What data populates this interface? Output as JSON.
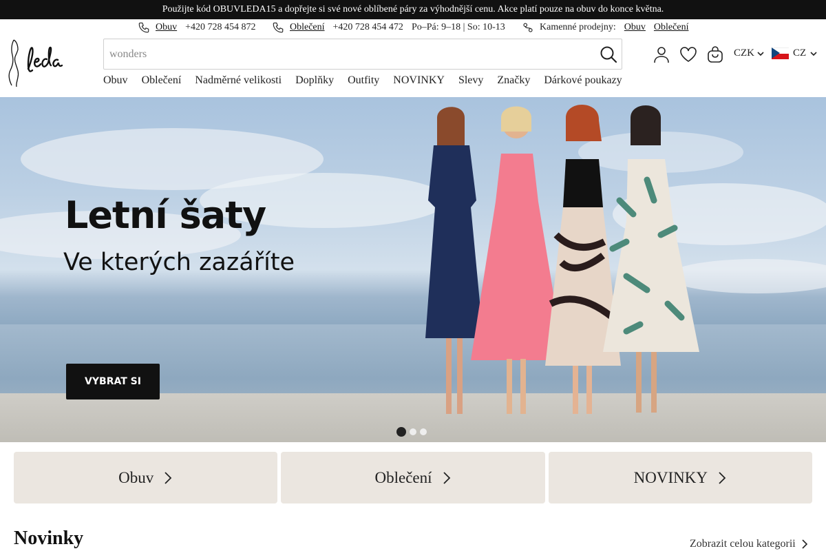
{
  "promo": {
    "text": "Použijte kód OBUVLEDA15 a dopřejte si své nové oblíbené páry za výhodnější cenu. Akce platí pouze na obuv do konce května."
  },
  "contacts": {
    "shoes_link": "Obuv",
    "shoes_phone": "+420 728 454 872",
    "clothes_link": "Oblečení",
    "clothes_phone": "+420 728 454 472",
    "hours": "Po–Pá: 9–18 | So: 10-13",
    "stores_label": "Kamenné prodejny:",
    "stores_shoes": "Obuv",
    "stores_clothes": "Oblečení"
  },
  "search": {
    "placeholder": "wonders"
  },
  "header": {
    "currency": "CZK",
    "language": "CZ"
  },
  "nav": [
    "Obuv",
    "Oblečení",
    "Nadměrné velikosti",
    "Doplňky",
    "Outfity",
    "NOVINKY",
    "Slevy",
    "Značky",
    "Dárkové poukazy"
  ],
  "hero": {
    "title": "Letní šaty",
    "subtitle": "Ve kterých zazáříte",
    "cta": "VYBRAT SI",
    "slides": 3,
    "active_slide": 1
  },
  "tiles": [
    "Obuv",
    "Oblečení",
    "NOVINKY"
  ],
  "section": {
    "title": "Novinky",
    "see_all": "Zobrazit celou kategorii"
  },
  "colors": {
    "dark": "#111111",
    "tile_bg": "#ebe6e0",
    "flag_red": "#d7141a",
    "flag_blue": "#11457e"
  },
  "icons": [
    "phone-icon",
    "store-location-icon",
    "search-icon",
    "user-icon",
    "heart-icon",
    "cart-icon",
    "chevron-down-icon",
    "chevron-right-icon"
  ]
}
